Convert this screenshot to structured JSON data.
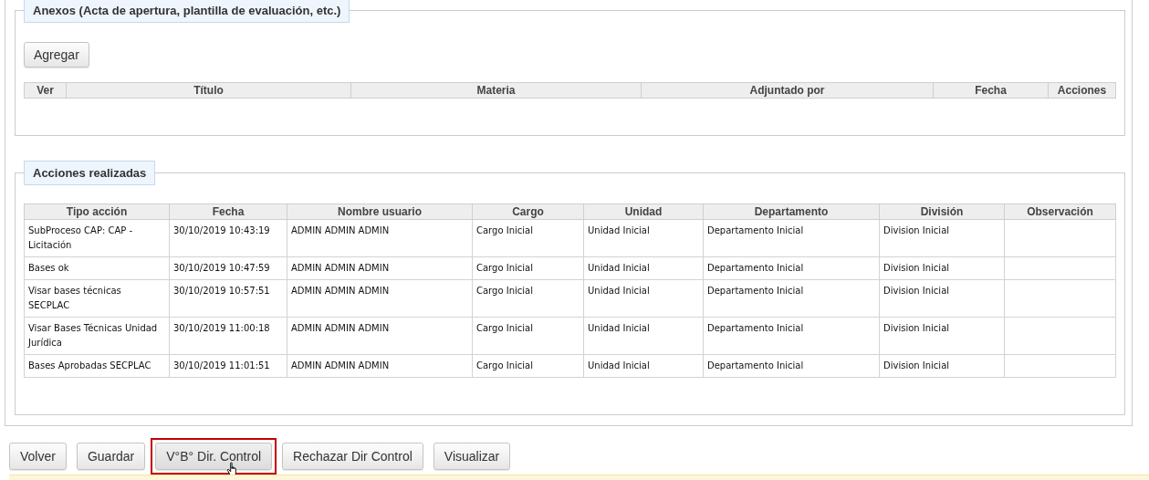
{
  "anexos": {
    "legend": "Anexos (Acta de apertura, plantilla de evaluación, etc.)",
    "add_button": "Agregar",
    "table": {
      "columns": [
        "Ver",
        "Título",
        "Materia",
        "Adjuntado por",
        "Fecha",
        "Acciones"
      ]
    }
  },
  "acciones": {
    "legend": "Acciones realizadas",
    "table": {
      "columns": [
        "Tipo acción",
        "Fecha",
        "Nombre usuario",
        "Cargo",
        "Unidad",
        "Departamento",
        "División",
        "Observación"
      ],
      "rows": [
        [
          "SubProceso CAP: CAP - Licitación",
          "30/10/2019 10:43:19",
          "ADMIN ADMIN ADMIN",
          "Cargo Inicial",
          "Unidad Inicial",
          "Departamento Inicial",
          "Division Inicial"
        ],
        [
          "Bases ok",
          "30/10/2019 10:47:59",
          "ADMIN ADMIN ADMIN",
          "Cargo Inicial",
          "Unidad Inicial",
          "Departamento Inicial",
          "Division Inicial"
        ],
        [
          "Visar bases técnicas SECPLAC",
          "30/10/2019 10:57:51",
          "ADMIN ADMIN ADMIN",
          "Cargo Inicial",
          "Unidad Inicial",
          "Departamento Inicial",
          "Division Inicial"
        ],
        [
          "Visar Bases Técnicas Unidad Jurídica",
          "30/10/2019 11:00:18",
          "ADMIN ADMIN ADMIN",
          "Cargo Inicial",
          "Unidad Inicial",
          "Departamento Inicial",
          "Division Inicial"
        ],
        [
          "Bases Aprobadas SECPLAC",
          "30/10/2019 11:01:51",
          "ADMIN ADMIN ADMIN",
          "Cargo Inicial",
          "Unidad Inicial",
          "Departamento Inicial",
          "Division Inicial"
        ]
      ]
    }
  },
  "buttons": [
    {
      "label": "Volver",
      "highlighted": false
    },
    {
      "label": "Guardar",
      "highlighted": false
    },
    {
      "label": "V°B° Dir. Control",
      "highlighted": true
    },
    {
      "label": "Rechazar Dir Control",
      "highlighted": false
    },
    {
      "label": "Visualizar",
      "highlighted": false
    }
  ]
}
